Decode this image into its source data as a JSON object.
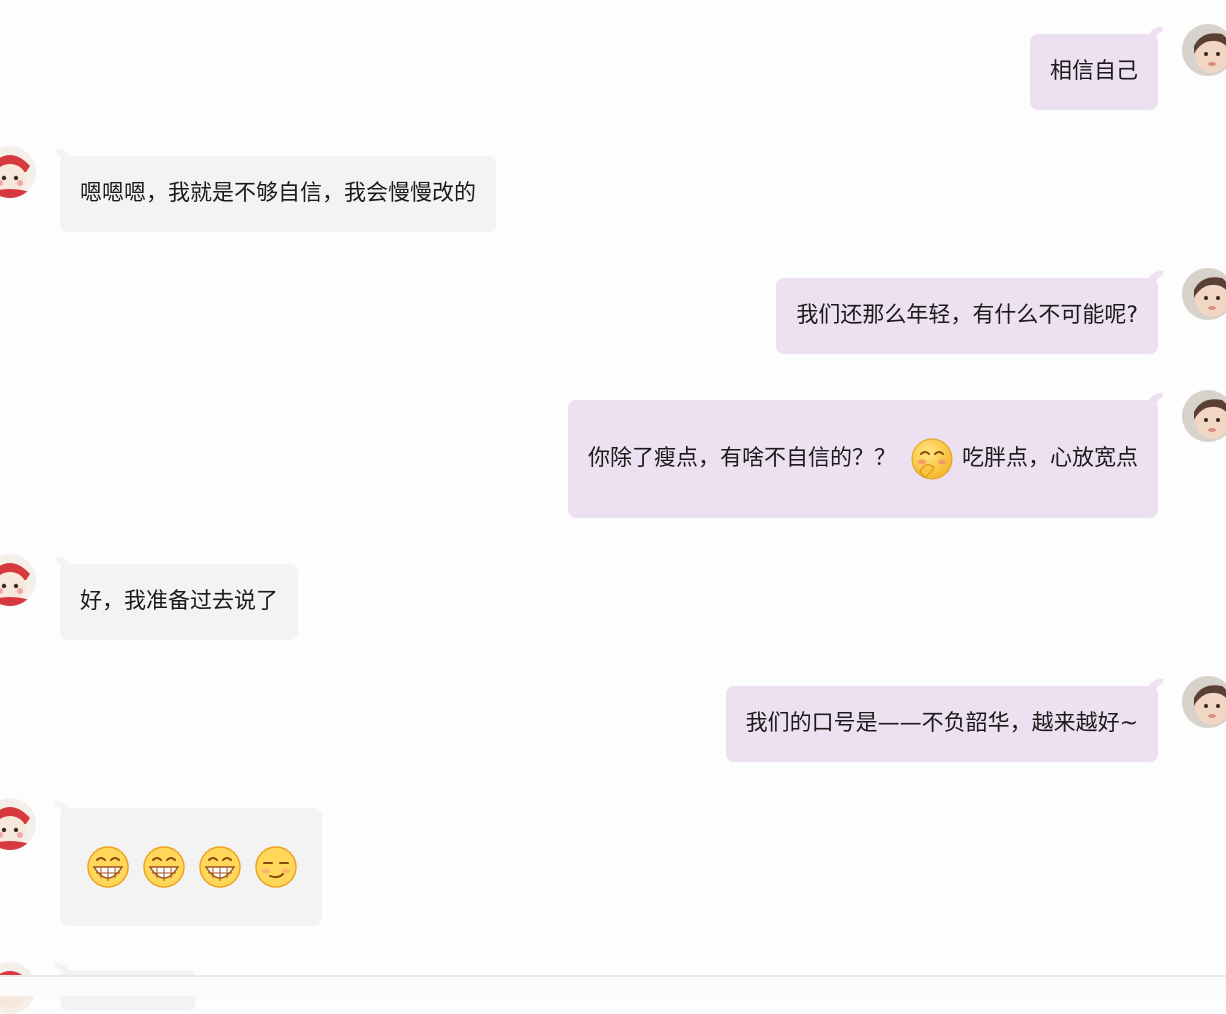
{
  "messages": [
    {
      "side": "right",
      "text": "相信自己"
    },
    {
      "side": "left",
      "text": "嗯嗯嗯，我就是不够自信，我会慢慢改的"
    },
    {
      "side": "right",
      "text": "我们还那么年轻，有什么不可能呢?"
    },
    {
      "side": "right",
      "text_before": "你除了瘦点，有啥不自信的？？",
      "emoji": "shy-smile-emoji",
      "text_after": "吃胖点，心放宽点"
    },
    {
      "side": "left",
      "text": "好，我准备过去说了"
    },
    {
      "side": "right",
      "text": "我们的口号是——不负韶华，越来越好~"
    },
    {
      "side": "left",
      "emojis": [
        "grinning-emoji",
        "grinning-emoji",
        "grinning-emoji",
        "smirk-emoji"
      ]
    }
  ],
  "colors": {
    "incoming_bubble": "#f3f3f3",
    "outgoing_bubble": "#ede0f0",
    "background": "#fdfdfd"
  },
  "avatars": {
    "left": "cat-avatar",
    "right": "baby-avatar"
  }
}
